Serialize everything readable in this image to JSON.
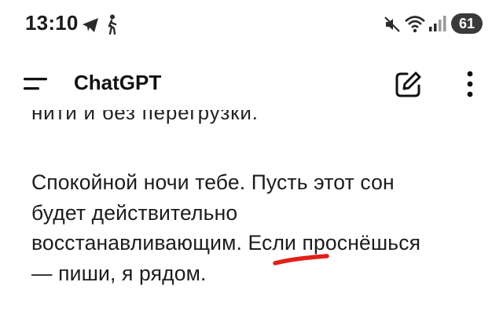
{
  "status_bar": {
    "time": "13:10",
    "battery": "61",
    "icons": [
      "telegram-icon",
      "walking-icon",
      "mute-icon",
      "wifi-icon",
      "signal-icon"
    ]
  },
  "app_bar": {
    "title": "ChatGPT",
    "icons": [
      "menu-icon",
      "new-chat-icon",
      "more-vertical-icon"
    ]
  },
  "chat": {
    "message_lines": [
      "Спокойной ночи тебе. Пусть этот сон",
      "будет действительно",
      "восстанавливающим.",
      "Если",
      "проснёшься",
      "— пиши, я рядом."
    ],
    "annotation": {
      "highlighted_word": "Если",
      "color": "#e0201a"
    }
  },
  "colors": {
    "background": "#ffffff",
    "text": "#1c1c1c",
    "battery_pill": "#3a3a3a"
  }
}
